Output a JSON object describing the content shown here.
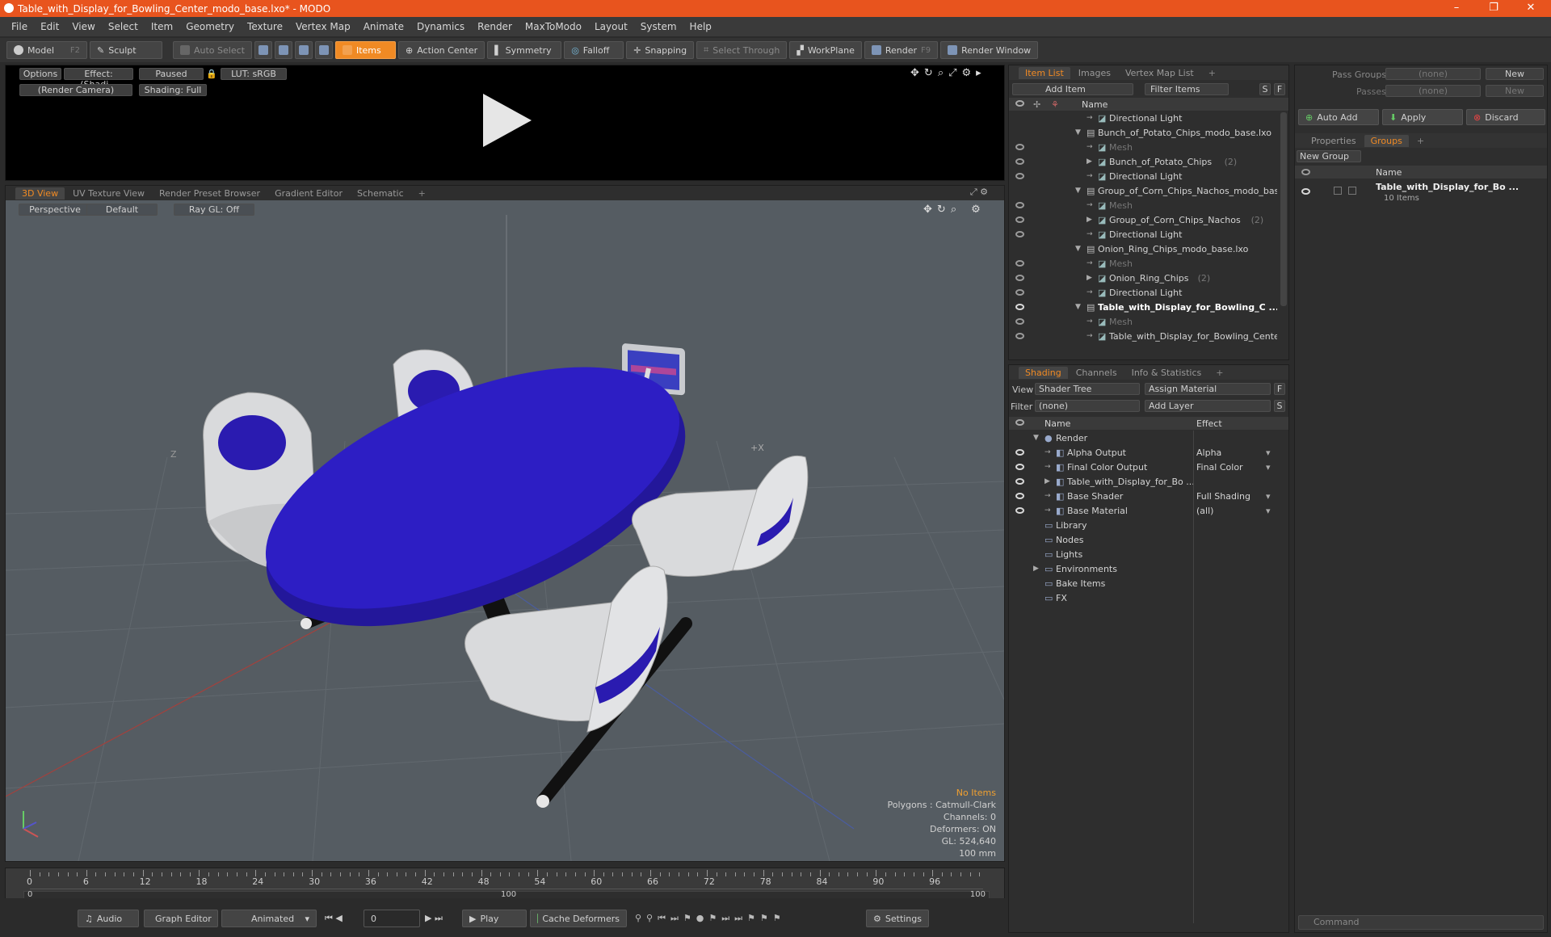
{
  "window": {
    "title": "Table_with_Display_for_Bowling_Center_modo_base.lxo* - MODO",
    "min": "–",
    "max": "❐",
    "close": "✕"
  },
  "menu": [
    "File",
    "Edit",
    "View",
    "Select",
    "Item",
    "Geometry",
    "Texture",
    "Vertex Map",
    "Animate",
    "Dynamics",
    "Render",
    "MaxToModo",
    "Layout",
    "System",
    "Help"
  ],
  "toolbar": {
    "model": "Model",
    "model_key": "F2",
    "sculpt": "Sculpt",
    "auto_select": "Auto Select",
    "items": "Items",
    "action_center": "Action Center",
    "symmetry": "Symmetry",
    "falloff": "Falloff",
    "snapping": "Snapping",
    "select_through": "Select Through",
    "workplane": "WorkPlane",
    "render": "Render",
    "render_key": "F9",
    "render_window": "Render Window"
  },
  "preview": {
    "options": "Options",
    "effect": "Effect: (Shadi...",
    "paused": "Paused",
    "lut": "LUT: sRGB",
    "camera": "(Render Camera)",
    "shading": "Shading: Full"
  },
  "viewport_tabs": [
    "3D View",
    "UV Texture View",
    "Render Preset Browser",
    "Gradient Editor",
    "Schematic",
    "+"
  ],
  "viewport": {
    "perspective": "Perspective",
    "default": "Default",
    "raygl": "Ray GL: Off",
    "axis_z": "Z",
    "axis_x": "+X",
    "hud": {
      "no_items": "No Items",
      "polygons": "Polygons : Catmull-Clark",
      "channels": "Channels: 0",
      "deformers": "Deformers: ON",
      "gl": "GL: 524,640",
      "unit": "100 mm"
    }
  },
  "timeline": {
    "ticks": [
      "0",
      "6",
      "12",
      "18",
      "24",
      "30",
      "36",
      "42",
      "48",
      "54",
      "60",
      "66",
      "72",
      "78",
      "84",
      "90",
      "96"
    ],
    "range_start": "0",
    "range_mid": "100",
    "range_end": "100"
  },
  "transport": {
    "audio": "Audio",
    "graph_editor": "Graph Editor",
    "animated": "Animated",
    "frame": "0",
    "play": "Play",
    "cache": "Cache Deformers",
    "settings": "Settings"
  },
  "item_list": {
    "tabs": [
      "Item List",
      "Images",
      "Vertex Map List",
      "+"
    ],
    "add_item": "Add Item",
    "filter": "Filter Items",
    "s": "S",
    "f": "F",
    "name_header": "Name",
    "rows": [
      {
        "label": "Directional Light",
        "indent": 2,
        "count": "",
        "dim": false,
        "eye": false,
        "bold": false
      },
      {
        "label": "Bunch_of_Potato_Chips_modo_base.lxo",
        "indent": 1,
        "count": "",
        "dim": false,
        "eye": false,
        "bold": false
      },
      {
        "label": "Mesh",
        "indent": 2,
        "count": "",
        "dim": true,
        "eye": true,
        "bold": false
      },
      {
        "label": "Bunch_of_Potato_Chips",
        "indent": 2,
        "count": "(2)",
        "dim": false,
        "eye": true,
        "bold": false
      },
      {
        "label": "Directional Light",
        "indent": 2,
        "count": "",
        "dim": false,
        "eye": true,
        "bold": false
      },
      {
        "label": "Group_of_Corn_Chips_Nachos_modo_bas...",
        "indent": 1,
        "count": "",
        "dim": false,
        "eye": false,
        "bold": false
      },
      {
        "label": "Mesh",
        "indent": 2,
        "count": "",
        "dim": true,
        "eye": true,
        "bold": false
      },
      {
        "label": "Group_of_Corn_Chips_Nachos",
        "indent": 2,
        "count": "(2)",
        "dim": false,
        "eye": true,
        "bold": false
      },
      {
        "label": "Directional Light",
        "indent": 2,
        "count": "",
        "dim": false,
        "eye": true,
        "bold": false
      },
      {
        "label": "Onion_Ring_Chips_modo_base.lxo",
        "indent": 1,
        "count": "",
        "dim": false,
        "eye": false,
        "bold": false
      },
      {
        "label": "Mesh",
        "indent": 2,
        "count": "",
        "dim": true,
        "eye": true,
        "bold": false
      },
      {
        "label": "Onion_Ring_Chips",
        "indent": 2,
        "count": "(2)",
        "dim": false,
        "eye": true,
        "bold": false
      },
      {
        "label": "Directional Light",
        "indent": 2,
        "count": "",
        "dim": false,
        "eye": true,
        "bold": false
      },
      {
        "label": "Table_with_Display_for_Bowling_C ...",
        "indent": 1,
        "count": "",
        "dim": false,
        "eye": true,
        "bold": true
      },
      {
        "label": "Mesh",
        "indent": 2,
        "count": "",
        "dim": true,
        "eye": true,
        "bold": false
      },
      {
        "label": "Table_with_Display_for_Bowling_Cente ...",
        "indent": 2,
        "count": "",
        "dim": false,
        "eye": true,
        "bold": false
      }
    ]
  },
  "shading": {
    "tabs": [
      "Shading",
      "Channels",
      "Info & Statistics",
      "+"
    ],
    "view_label": "View",
    "view_value": "Shader Tree",
    "assign": "Assign Material",
    "f": "F",
    "filter_label": "Filter",
    "filter_value": "(none)",
    "add_layer": "Add Layer",
    "s": "S",
    "name_header": "Name",
    "effect_header": "Effect",
    "rows": [
      {
        "label": "Render",
        "effect": "",
        "indent": 1,
        "eye": false
      },
      {
        "label": "Alpha Output",
        "effect": "Alpha",
        "indent": 2,
        "eye": true
      },
      {
        "label": "Final Color Output",
        "effect": "Final Color",
        "indent": 2,
        "eye": true
      },
      {
        "label": "Table_with_Display_for_Bo ...",
        "effect": "",
        "indent": 2,
        "eye": true
      },
      {
        "label": "Base Shader",
        "effect": "Full Shading",
        "indent": 2,
        "eye": true
      },
      {
        "label": "Base Material",
        "effect": "(all)",
        "indent": 2,
        "eye": true
      },
      {
        "label": "Library",
        "effect": "",
        "indent": 1,
        "eye": false
      },
      {
        "label": "Nodes",
        "effect": "",
        "indent": 1,
        "eye": false
      },
      {
        "label": "Lights",
        "effect": "",
        "indent": 1,
        "eye": false
      },
      {
        "label": "Environments",
        "effect": "",
        "indent": 1,
        "eye": false
      },
      {
        "label": "Bake Items",
        "effect": "",
        "indent": 1,
        "eye": false
      },
      {
        "label": "FX",
        "effect": "",
        "indent": 1,
        "eye": false
      }
    ]
  },
  "groups": {
    "pass_groups": "Pass Groups",
    "passes": "Passes",
    "none": "(none)",
    "new": "New",
    "auto_add": "Auto Add",
    "apply": "Apply",
    "discard": "Discard",
    "tabs": [
      "Properties",
      "Groups",
      "+"
    ],
    "new_group": "New Group",
    "name_header": "Name",
    "group_name": "Table_with_Display_for_Bo ...",
    "group_count": "10 Items"
  },
  "command": {
    "placeholder": "Command"
  },
  "colors": {
    "accent": "#f08a24",
    "title_bar": "#e8541e",
    "table_blue": "#2a1bb0"
  }
}
